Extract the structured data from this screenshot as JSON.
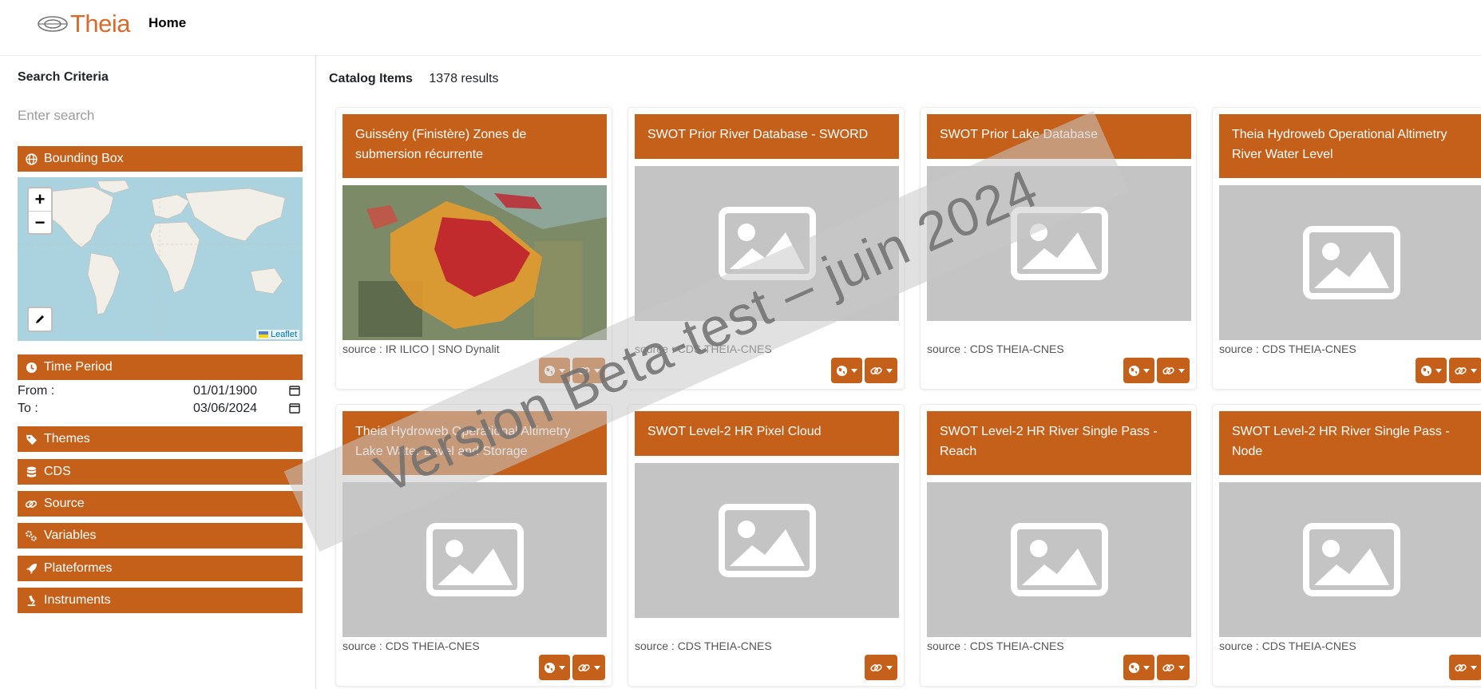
{
  "app": {
    "logo_text": "Theia",
    "nav_home": "Home"
  },
  "sidebar": {
    "title": "Search Criteria",
    "search_placeholder": "Enter search",
    "bounding_box": {
      "label": "Bounding Box",
      "icon": "globe-icon"
    },
    "map": {
      "zoom_in": "+",
      "zoom_out": "−",
      "attribution": "Leaflet"
    },
    "time_period": {
      "label": "Time Period",
      "icon": "clock-icon",
      "from_label": "From :",
      "from_value": "01/01/1900",
      "to_label": "To :",
      "to_value": "03/06/2024"
    },
    "facets": [
      {
        "label": "Themes",
        "icon": "tag-icon"
      },
      {
        "label": "CDS",
        "icon": "database-icon"
      },
      {
        "label": "Source",
        "icon": "link-icon"
      },
      {
        "label": "Variables",
        "icon": "gears-icon"
      },
      {
        "label": "Plateformes",
        "icon": "rocket-icon"
      },
      {
        "label": "Instruments",
        "icon": "microscope-icon"
      }
    ]
  },
  "catalog": {
    "title": "Catalog Items",
    "count": "1378 results",
    "items": [
      {
        "title": "Guissény (Finistère) Zones de submersion récurrente",
        "source": "source : IR ILICO | SNO Dynalit",
        "image": "satellite-map",
        "buttons": [
          "map-menu",
          "link-menu"
        ]
      },
      {
        "title": "SWOT Prior River Database - SWORD",
        "source": "source : CDS THEIA-CNES",
        "image": "placeholder",
        "buttons": [
          "map-menu",
          "link-menu"
        ]
      },
      {
        "title": "SWOT Prior Lake Database",
        "source": "source : CDS THEIA-CNES",
        "image": "placeholder",
        "buttons": [
          "map-menu",
          "link-menu"
        ]
      },
      {
        "title": "Theia Hydroweb Operational Altimetry River Water Level",
        "source": "source : CDS THEIA-CNES",
        "image": "placeholder",
        "buttons": [
          "map-menu",
          "link-menu"
        ]
      },
      {
        "title": "Theia Hydroweb Operational Altimetry Lake Water Level and Storage",
        "source": "source : CDS THEIA-CNES",
        "image": "placeholder",
        "buttons": [
          "map-menu",
          "link-menu"
        ]
      },
      {
        "title": "SWOT Level-2 HR Pixel Cloud",
        "source": "source : CDS THEIA-CNES",
        "image": "placeholder",
        "buttons": [
          "link-menu"
        ]
      },
      {
        "title": "SWOT Level-2 HR River Single Pass - Reach",
        "source": "source : CDS THEIA-CNES",
        "image": "placeholder",
        "buttons": [
          "map-menu",
          "link-menu"
        ]
      },
      {
        "title": "SWOT Level-2 HR River Single Pass - Node",
        "source": "source : CDS THEIA-CNES",
        "image": "placeholder",
        "buttons": [
          "link-menu"
        ]
      }
    ]
  },
  "watermark": "Version Beta-test – juin 2024",
  "colors": {
    "accent": "#c4601a",
    "logo": "#d96a2a",
    "placeholder_bg": "#c4c4c4"
  }
}
